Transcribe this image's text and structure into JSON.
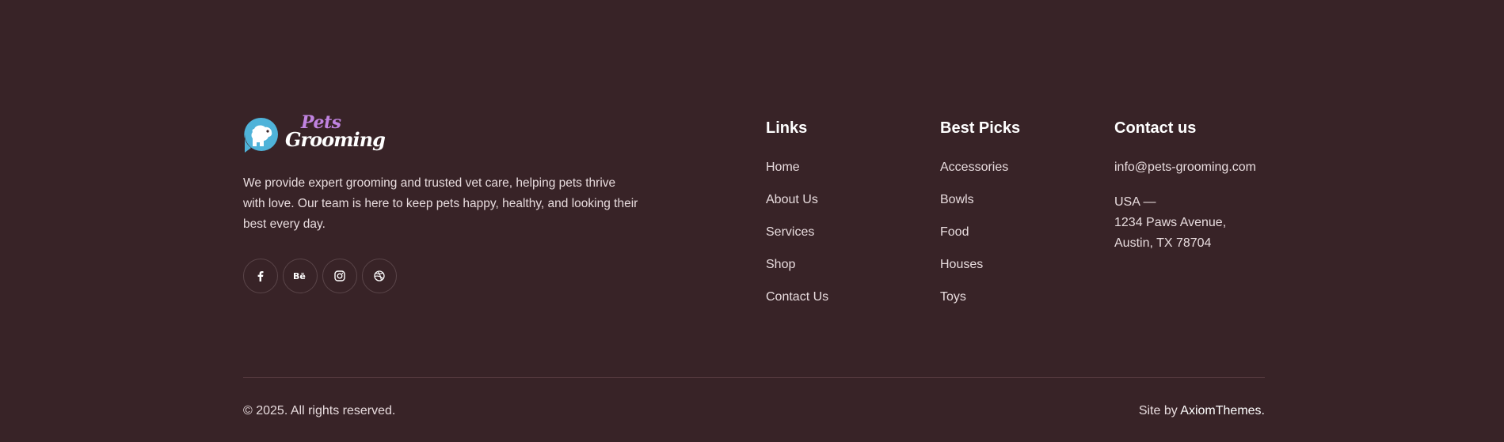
{
  "brand": {
    "logo_word_1": "Pets",
    "logo_word_2": "Grooming",
    "description": "We provide expert grooming and trusted vet care, helping pets thrive with love. Our team is here to keep pets happy, healthy, and looking their best every day.",
    "logo_icon": "dog-head-icon",
    "accent_color": "#4fb3d9",
    "logo_accent_color": "#c083e0"
  },
  "social": [
    {
      "icon": "facebook-icon",
      "label": "f"
    },
    {
      "icon": "behance-icon",
      "label": "Bē"
    },
    {
      "icon": "instagram-icon"
    },
    {
      "icon": "dribbble-icon"
    }
  ],
  "links": {
    "title": "Links",
    "items": [
      "Home",
      "About Us",
      "Services",
      "Shop",
      "Contact Us"
    ]
  },
  "best_picks": {
    "title": "Best Picks",
    "items": [
      "Accessories",
      "Bowls",
      "Food",
      "Houses",
      "Toys"
    ]
  },
  "contact": {
    "title": "Contact us",
    "email": "info@pets-grooming.com",
    "address_line_1": "USA —",
    "address_line_2": "1234 Paws Avenue,",
    "address_line_3": "Austin, TX 78704"
  },
  "bottom": {
    "copyright": "© 2025. All rights reserved.",
    "site_by_prefix": "Site by ",
    "site_by_link": "AxiomThemes."
  },
  "colors": {
    "background": "#382327",
    "text": "#e8dcde",
    "heading": "#ffffff",
    "divider": "#54393e"
  }
}
